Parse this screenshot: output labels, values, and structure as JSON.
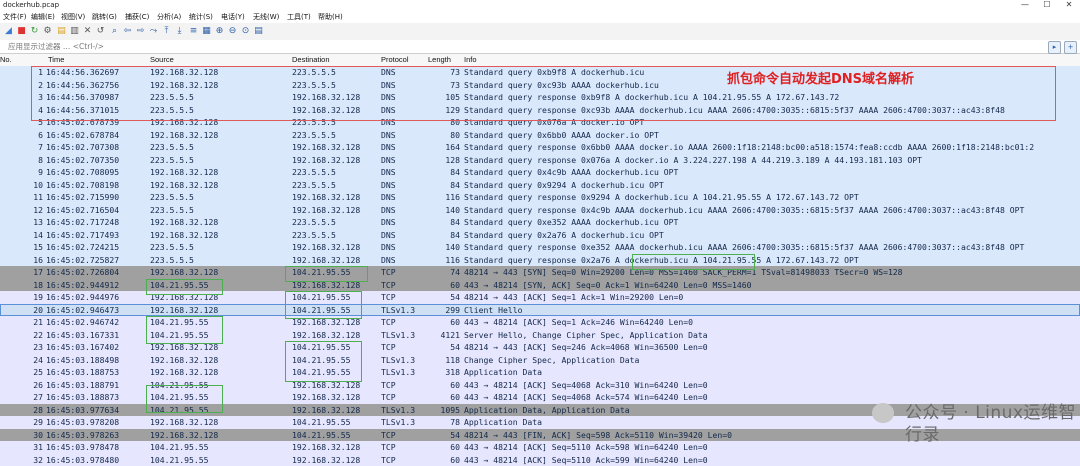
{
  "window": {
    "title": "dockerhub.pcap",
    "controls": {
      "minimize": "—",
      "maximize": "☐",
      "close": "✕"
    }
  },
  "menu": [
    "文件(F)",
    "编辑(E)",
    "视图(V)",
    "跳转(G)",
    "捕获(C)",
    "分析(A)",
    "统计(S)",
    "电话(Y)",
    "无线(W)",
    "工具(T)",
    "帮助(H)"
  ],
  "filter": {
    "placeholder": "应用显示过滤器 … <Ctrl-/>"
  },
  "columns": {
    "no": "No.",
    "time": "Time",
    "source": "Source",
    "destination": "Destination",
    "protocol": "Protocol",
    "length": "Length",
    "info": "Info"
  },
  "annotation": "抓包命令自动发起DNS域名解析",
  "watermark": "公众号 · Linux运维智行录",
  "colors": {
    "dns": "#dae8fc",
    "tcp": "#e7e6ff",
    "tcp_syn_fin": "#a0a0a0",
    "selected_row": "#cfe0f5"
  },
  "packets": [
    {
      "no": "1",
      "time": "16:44:56.362697",
      "src": "192.168.32.128",
      "dst": "223.5.5.5",
      "proto": "DNS",
      "len": "73",
      "info": "Standard query 0xb9f8 A dockerhub.icu",
      "kind": "dns"
    },
    {
      "no": "2",
      "time": "16:44:56.362756",
      "src": "192.168.32.128",
      "dst": "223.5.5.5",
      "proto": "DNS",
      "len": "73",
      "info": "Standard query 0xc93b AAAA dockerhub.icu",
      "kind": "dns"
    },
    {
      "no": "3",
      "time": "16:44:56.370987",
      "src": "223.5.5.5",
      "dst": "192.168.32.128",
      "proto": "DNS",
      "len": "105",
      "info": "Standard query response 0xb9f8 A dockerhub.icu A 104.21.95.55 A 172.67.143.72",
      "kind": "dns"
    },
    {
      "no": "4",
      "time": "16:44:56.371015",
      "src": "223.5.5.5",
      "dst": "192.168.32.128",
      "proto": "DNS",
      "len": "129",
      "info": "Standard query response 0xc93b AAAA dockerhub.icu AAAA 2606:4700:3035::6815:5f37 AAAA 2606:4700:3037::ac43:8f48",
      "kind": "dns"
    },
    {
      "no": "5",
      "time": "16:45:02.678739",
      "src": "192.168.32.128",
      "dst": "223.5.5.5",
      "proto": "DNS",
      "len": "80",
      "info": "Standard query 0x076a A docker.io OPT",
      "kind": "dns"
    },
    {
      "no": "6",
      "time": "16:45:02.678784",
      "src": "192.168.32.128",
      "dst": "223.5.5.5",
      "proto": "DNS",
      "len": "80",
      "info": "Standard query 0x6bb0 AAAA docker.io OPT",
      "kind": "dns"
    },
    {
      "no": "7",
      "time": "16:45:02.707308",
      "src": "223.5.5.5",
      "dst": "192.168.32.128",
      "proto": "DNS",
      "len": "164",
      "info": "Standard query response 0x6bb0 AAAA docker.io AAAA 2600:1f18:2148:bc00:a518:1574:fea8:ccdb AAAA 2600:1f18:2148:bc01:2",
      "kind": "dns"
    },
    {
      "no": "8",
      "time": "16:45:02.707350",
      "src": "223.5.5.5",
      "dst": "192.168.32.128",
      "proto": "DNS",
      "len": "128",
      "info": "Standard query response 0x076a A docker.io A 3.224.227.198 A 44.219.3.189 A 44.193.181.103 OPT",
      "kind": "dns"
    },
    {
      "no": "9",
      "time": "16:45:02.708095",
      "src": "192.168.32.128",
      "dst": "223.5.5.5",
      "proto": "DNS",
      "len": "84",
      "info": "Standard query 0x4c9b AAAA dockerhub.icu OPT",
      "kind": "dns"
    },
    {
      "no": "10",
      "time": "16:45:02.708198",
      "src": "192.168.32.128",
      "dst": "223.5.5.5",
      "proto": "DNS",
      "len": "84",
      "info": "Standard query 0x9294 A dockerhub.icu OPT",
      "kind": "dns"
    },
    {
      "no": "11",
      "time": "16:45:02.715990",
      "src": "223.5.5.5",
      "dst": "192.168.32.128",
      "proto": "DNS",
      "len": "116",
      "info": "Standard query response 0x9294 A dockerhub.icu A 104.21.95.55 A 172.67.143.72 OPT",
      "kind": "dns"
    },
    {
      "no": "12",
      "time": "16:45:02.716504",
      "src": "223.5.5.5",
      "dst": "192.168.32.128",
      "proto": "DNS",
      "len": "140",
      "info": "Standard query response 0x4c9b AAAA dockerhub.icu AAAA 2606:4700:3035::6815:5f37 AAAA 2606:4700:3037::ac43:8f48 OPT",
      "kind": "dns"
    },
    {
      "no": "13",
      "time": "16:45:02.717248",
      "src": "192.168.32.128",
      "dst": "223.5.5.5",
      "proto": "DNS",
      "len": "84",
      "info": "Standard query 0xe352 AAAA dockerhub.icu OPT",
      "kind": "dns"
    },
    {
      "no": "14",
      "time": "16:45:02.717493",
      "src": "192.168.32.128",
      "dst": "223.5.5.5",
      "proto": "DNS",
      "len": "84",
      "info": "Standard query 0x2a76 A dockerhub.icu OPT",
      "kind": "dns"
    },
    {
      "no": "15",
      "time": "16:45:02.724215",
      "src": "223.5.5.5",
      "dst": "192.168.32.128",
      "proto": "DNS",
      "len": "140",
      "info": "Standard query response 0xe352 AAAA dockerhub.icu AAAA 2606:4700:3035::6815:5f37 AAAA 2606:4700:3037::ac43:8f48 OPT",
      "kind": "dns"
    },
    {
      "no": "16",
      "time": "16:45:02.725827",
      "src": "223.5.5.5",
      "dst": "192.168.32.128",
      "proto": "DNS",
      "len": "116",
      "info": "Standard query response 0x2a76 A dockerhub.icu A 104.21.95.55 A 172.67.143.72 OPT",
      "kind": "dns"
    },
    {
      "no": "17",
      "time": "16:45:02.726804",
      "src": "192.168.32.128",
      "dst": "104.21.95.55",
      "proto": "TCP",
      "len": "74",
      "info": "48214 → 443 [SYN] Seq=0 Win=29200 Len=0 MSS=1460 SACK_PERM=1 TSval=81498033 TSecr=0 WS=128",
      "kind": "syn"
    },
    {
      "no": "18",
      "time": "16:45:02.944912",
      "src": "104.21.95.55",
      "dst": "192.168.32.128",
      "proto": "TCP",
      "len": "60",
      "info": "443 → 48214 [SYN, ACK] Seq=0 Ack=1 Win=64240 Len=0 MSS=1460",
      "kind": "syn"
    },
    {
      "no": "19",
      "time": "16:45:02.944976",
      "src": "192.168.32.128",
      "dst": "104.21.95.55",
      "proto": "TCP",
      "len": "54",
      "info": "48214 → 443 [ACK] Seq=1 Ack=1 Win=29200 Len=0",
      "kind": "tcp"
    },
    {
      "no": "20",
      "time": "16:45:02.946473",
      "src": "192.168.32.128",
      "dst": "104.21.95.55",
      "proto": "TLSv1.3",
      "len": "299",
      "info": "Client Hello",
      "kind": "selected"
    },
    {
      "no": "21",
      "time": "16:45:02.946742",
      "src": "104.21.95.55",
      "dst": "192.168.32.128",
      "proto": "TCP",
      "len": "60",
      "info": "443 → 48214 [ACK] Seq=1 Ack=246 Win=64240 Len=0",
      "kind": "tcp"
    },
    {
      "no": "22",
      "time": "16:45:03.167331",
      "src": "104.21.95.55",
      "dst": "192.168.32.128",
      "proto": "TLSv1.3",
      "len": "4121",
      "info": "Server Hello, Change Cipher Spec, Application Data",
      "kind": "tcp"
    },
    {
      "no": "23",
      "time": "16:45:03.167402",
      "src": "192.168.32.128",
      "dst": "104.21.95.55",
      "proto": "TCP",
      "len": "54",
      "info": "48214 → 443 [ACK] Seq=246 Ack=4068 Win=36500 Len=0",
      "kind": "tcp"
    },
    {
      "no": "24",
      "time": "16:45:03.188498",
      "src": "192.168.32.128",
      "dst": "104.21.95.55",
      "proto": "TLSv1.3",
      "len": "118",
      "info": "Change Cipher Spec, Application Data",
      "kind": "tcp"
    },
    {
      "no": "25",
      "time": "16:45:03.188753",
      "src": "192.168.32.128",
      "dst": "104.21.95.55",
      "proto": "TLSv1.3",
      "len": "318",
      "info": "Application Data",
      "kind": "tcp"
    },
    {
      "no": "26",
      "time": "16:45:03.188791",
      "src": "104.21.95.55",
      "dst": "192.168.32.128",
      "proto": "TCP",
      "len": "60",
      "info": "443 → 48214 [ACK] Seq=4068 Ack=310 Win=64240 Len=0",
      "kind": "tcp"
    },
    {
      "no": "27",
      "time": "16:45:03.188873",
      "src": "104.21.95.55",
      "dst": "192.168.32.128",
      "proto": "TCP",
      "len": "60",
      "info": "443 → 48214 [ACK] Seq=4068 Ack=574 Win=64240 Len=0",
      "kind": "tcp"
    },
    {
      "no": "28",
      "time": "16:45:03.977634",
      "src": "104.21.95.55",
      "dst": "192.168.32.128",
      "proto": "TLSv1.3",
      "len": "1095",
      "info": "Application Data, Application Data",
      "kind": "syn"
    },
    {
      "no": "29",
      "time": "16:45:03.978208",
      "src": "192.168.32.128",
      "dst": "104.21.95.55",
      "proto": "TLSv1.3",
      "len": "78",
      "info": "Application Data",
      "kind": "tcp"
    },
    {
      "no": "30",
      "time": "16:45:03.978263",
      "src": "192.168.32.128",
      "dst": "104.21.95.55",
      "proto": "TCP",
      "len": "54",
      "info": "48214 → 443 [FIN, ACK] Seq=598 Ack=5110 Win=39420 Len=0",
      "kind": "syn"
    },
    {
      "no": "31",
      "time": "16:45:03.978478",
      "src": "104.21.95.55",
      "dst": "192.168.32.128",
      "proto": "TCP",
      "len": "60",
      "info": "443 → 48214 [ACK] Seq=5110 Ack=598 Win=64240 Len=0",
      "kind": "tcp"
    },
    {
      "no": "32",
      "time": "16:45:03.978480",
      "src": "104.21.95.55",
      "dst": "192.168.32.128",
      "proto": "TCP",
      "len": "60",
      "info": "443 → 48214 [ACK] Seq=5110 Ack=599 Win=64240 Len=0",
      "kind": "tcp"
    }
  ]
}
